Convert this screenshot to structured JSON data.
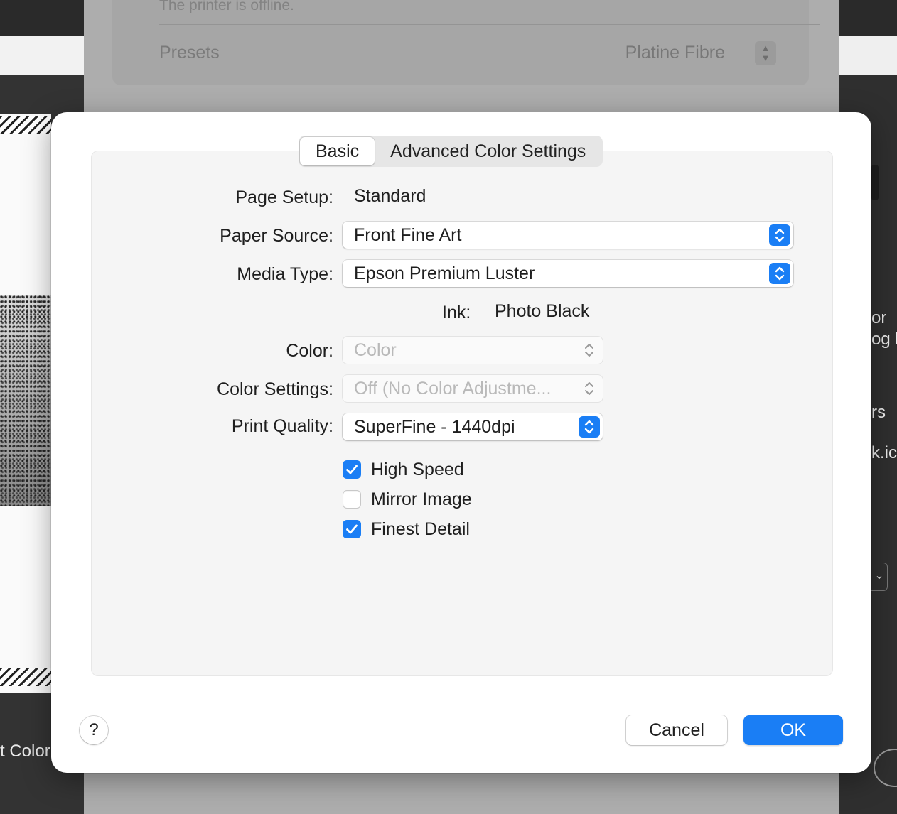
{
  "background": {
    "printer_status": "The printer is offline.",
    "presets_label": "Presets",
    "presets_value": "Platine Fibre",
    "left_fragment": "t Color",
    "right_fragments": [
      "or",
      "og l",
      "rs",
      "k.ic"
    ]
  },
  "tabs": [
    {
      "label": "Basic",
      "active": true
    },
    {
      "label": "Advanced Color Settings",
      "active": false
    }
  ],
  "form": {
    "page_setup_label": "Page Setup:",
    "page_setup_value": "Standard",
    "paper_source_label": "Paper Source:",
    "paper_source_value": "Front Fine Art",
    "media_type_label": "Media Type:",
    "media_type_value": "Epson Premium Luster",
    "ink_label": "Ink:",
    "ink_value": "Photo Black",
    "color_label": "Color:",
    "color_value": "Color",
    "color_settings_label": "Color Settings:",
    "color_settings_value": "Off (No Color Adjustme...",
    "print_quality_label": "Print Quality:",
    "print_quality_value": "SuperFine - 1440dpi"
  },
  "checkboxes": [
    {
      "label": "High Speed",
      "checked": true
    },
    {
      "label": "Mirror Image",
      "checked": false
    },
    {
      "label": "Finest Detail",
      "checked": true
    }
  ],
  "buttons": {
    "help": "?",
    "cancel": "Cancel",
    "ok": "OK"
  },
  "colors": {
    "accent": "#1a7ef5",
    "sheet_bg": "#ffffff",
    "panel_bg": "#f5f5f5"
  },
  "icons": {
    "popup_chevron": "chevron-updown-icon",
    "checkmark": "checkmark-icon"
  }
}
